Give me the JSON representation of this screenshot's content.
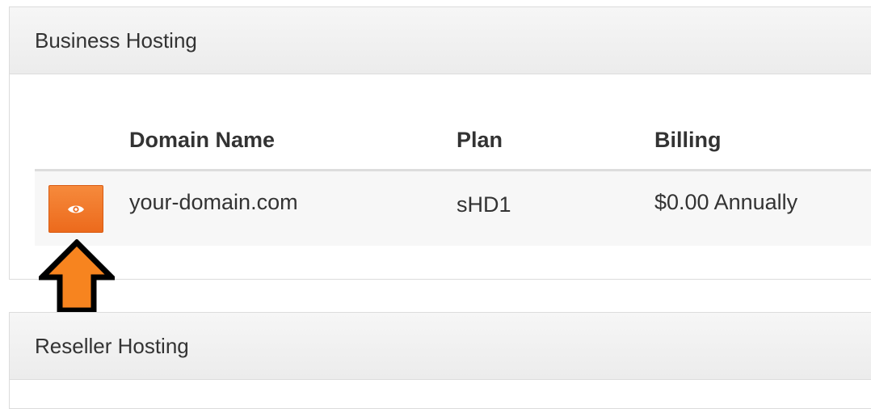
{
  "business_panel": {
    "title": "Business Hosting",
    "columns": [
      "Domain Name",
      "Plan",
      "Billing"
    ],
    "rows": [
      {
        "domain": "your-domain.com",
        "plan": "sHD1",
        "billing": "$0.00 Annually",
        "action_icon": "eye-icon"
      }
    ]
  },
  "reseller_panel": {
    "title": "Reseller Hosting"
  },
  "annotation": {
    "icon": "up-arrow-icon",
    "fill_color": "#f7841f",
    "stroke_color": "#000000"
  },
  "colors": {
    "button_accent": "#f0772a"
  }
}
